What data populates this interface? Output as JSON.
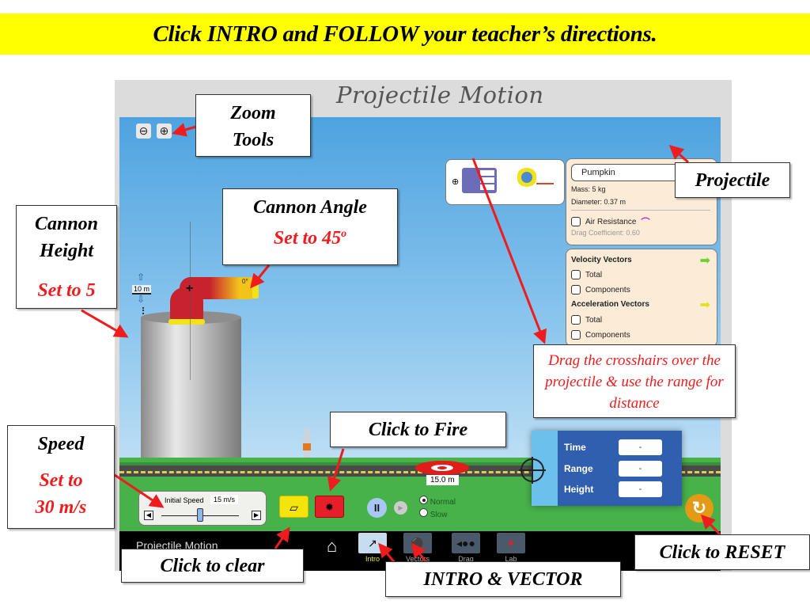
{
  "banner": {
    "text": "Click INTRO and FOLLOW your teacher’s directions."
  },
  "sim": {
    "title": "Projectile Motion",
    "zoom_out_icon": "zoom-out-icon",
    "zoom_in_icon": "zoom-in-icon",
    "height_label": "10 m",
    "angle_label": "0°",
    "target_distance": "15.0 m",
    "projectile_panel": {
      "selected": "Pumpkin",
      "mass": "Mass: 5 kg",
      "diameter": "Diameter: 0.37 m",
      "air_resistance_label": "Air Resistance",
      "air_resistance_checked": false,
      "drag_coefficient": "Drag Coefficient: 0.60"
    },
    "vectors_panel": {
      "velocity_header": "Velocity Vectors",
      "velocity_total": "Total",
      "velocity_components": "Components",
      "acceleration_header": "Acceleration Vectors",
      "acceleration_total": "Total",
      "acceleration_components": "Components",
      "velocity_arrow_color": "#6cd12a",
      "acceleration_arrow_color": "#e2e21a"
    },
    "speed": {
      "label": "Initial Speed",
      "value": "15 m/s",
      "slider_fraction": 0.5
    },
    "speed_modes": {
      "normal": "Normal",
      "slow": "Slow",
      "selected": "Normal"
    },
    "measure": {
      "time_label": "Time",
      "time_value": "-",
      "range_label": "Range",
      "range_value": "-",
      "height_label": "Height",
      "height_value": "-"
    },
    "nav": {
      "app_name": "Projectile Motion",
      "tabs": [
        {
          "label": "Intro",
          "active": true
        },
        {
          "label": "Vectors",
          "active": false
        },
        {
          "label": "Drag",
          "active": false
        },
        {
          "label": "Lab",
          "active": false
        }
      ]
    }
  },
  "annotations": {
    "zoom_tools": [
      "Zoom",
      "Tools"
    ],
    "cannon_height": {
      "title": [
        "Cannon",
        "Height"
      ],
      "instruction": "Set to 5"
    },
    "cannon_angle": {
      "title": "Cannon Angle",
      "instruction": "Set to 45",
      "superscript": "o"
    },
    "projectile": "Projectile",
    "crosshairs": "Drag the crosshairs over the projectile & use the range for distance",
    "fire": "Click to Fire",
    "speed": {
      "title": "Speed",
      "instruction": [
        "Set to",
        "30 m/s"
      ]
    },
    "clear": "Click to clear",
    "reset": "Click to RESET",
    "intro_vector": "INTRO & VECTOR"
  },
  "colors": {
    "banner": "#ffff00",
    "annotation_red": "#ee1c1c",
    "grass": "#47b14a",
    "sky": "#5aaae2"
  }
}
